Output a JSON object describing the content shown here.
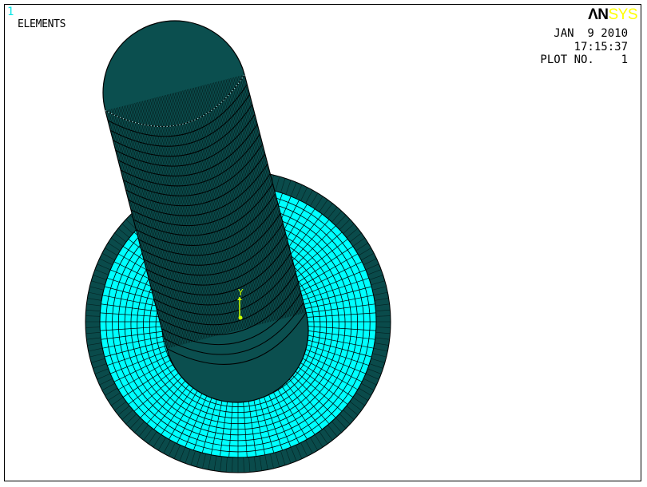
{
  "window": {
    "number": "1",
    "plot_label": "ELEMENTS"
  },
  "logo": {
    "part1": "ΛN",
    "part2": "SYS"
  },
  "stamp": {
    "date": "JAN  9 2010",
    "time": "17:15:37",
    "plot_number": "PLOT NO.    1"
  },
  "triad": {
    "axis_label": "Y"
  },
  "colors": {
    "background": "#ffffff",
    "base_mesh": "#00ffff",
    "rim_mesh": "#0a4b4b",
    "cylinder": "#0b4f4f",
    "mesh_lines": "#000000",
    "triad": "#c8ff00",
    "window_number": "#00e5e5",
    "logo_an": "#000000",
    "logo_sys": "#ffff00"
  }
}
